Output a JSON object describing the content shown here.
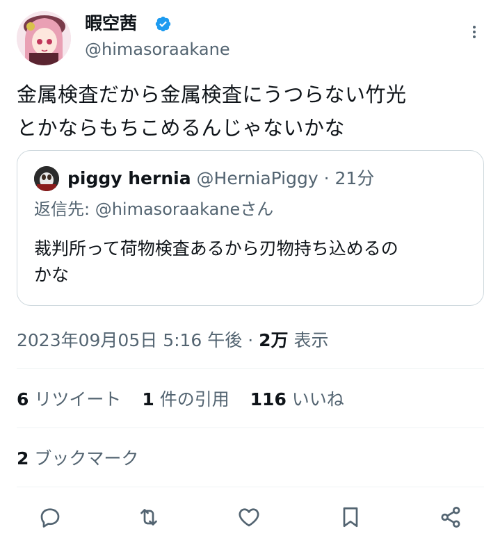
{
  "author": {
    "display_name": "暇空茜",
    "handle": "@himasoraakane",
    "verified": true
  },
  "tweet": {
    "text_line1": "金属検査だから金属検査にうつらない竹光",
    "text_line2": "とかならもちこめるんじゃないかな"
  },
  "quote": {
    "name": "piggy hernia",
    "handle": "@HerniaPiggy",
    "separator": " · ",
    "time": "21分",
    "reply_prefix": "返信先: ",
    "reply_handle": "@himasoraakane",
    "reply_suffix": "さん",
    "text_line1": "裁判所って荷物検査あるから刃物持ち込めるの",
    "text_line2": "かな"
  },
  "meta": {
    "datetime": "2023年09月05日 5:16 午後",
    "separator": " · ",
    "views_count": "2万",
    "views_label": "表示"
  },
  "stats": {
    "retweets_count": "6",
    "retweets_label": "リツイート",
    "quotes_count": "1",
    "quotes_label": "件の引用",
    "likes_count": "116",
    "likes_label": "いいね",
    "bookmarks_count": "2",
    "bookmarks_label": "ブックマーク"
  },
  "colors": {
    "text": "#0f1419",
    "secondary": "#536471",
    "verified": "#1d9bf0",
    "border": "#cfd9de"
  },
  "icons": [
    "verified-badge-icon",
    "more-icon",
    "reply-icon",
    "retweet-icon",
    "like-icon",
    "bookmark-icon",
    "share-icon"
  ]
}
